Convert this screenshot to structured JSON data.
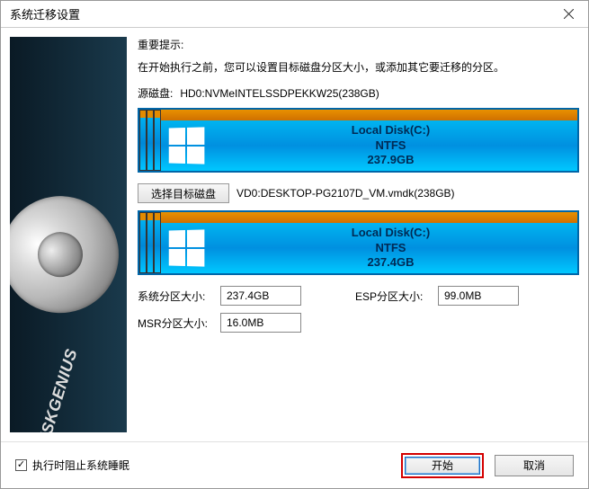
{
  "window": {
    "title": "系统迁移设置"
  },
  "hint": {
    "title": "重要提示:",
    "text": "在开始执行之前，您可以设置目标磁盘分区大小，或添加其它要迁移的分区。"
  },
  "sourceDisk": {
    "label": "源磁盘:",
    "name": "HD0:NVMeINTELSSDPEKKW25(238GB)",
    "partition": {
      "title": "Local Disk(C:)",
      "fs": "NTFS",
      "size": "237.9GB"
    }
  },
  "targetDisk": {
    "button": "选择目标磁盘",
    "name": "VD0:DESKTOP-PG2107D_VM.vmdk(238GB)",
    "partition": {
      "title": "Local Disk(C:)",
      "fs": "NTFS",
      "size": "237.4GB"
    }
  },
  "fields": {
    "sysLabel": "系统分区大小:",
    "sysValue": "237.4GB",
    "espLabel": "ESP分区大小:",
    "espValue": "99.0MB",
    "msrLabel": "MSR分区大小:",
    "msrValue": "16.0MB"
  },
  "footer": {
    "checkboxLabel": "执行时阻止系统睡眠",
    "startLabel": "开始",
    "cancelLabel": "取消"
  },
  "brand": "DISKGENIUS"
}
